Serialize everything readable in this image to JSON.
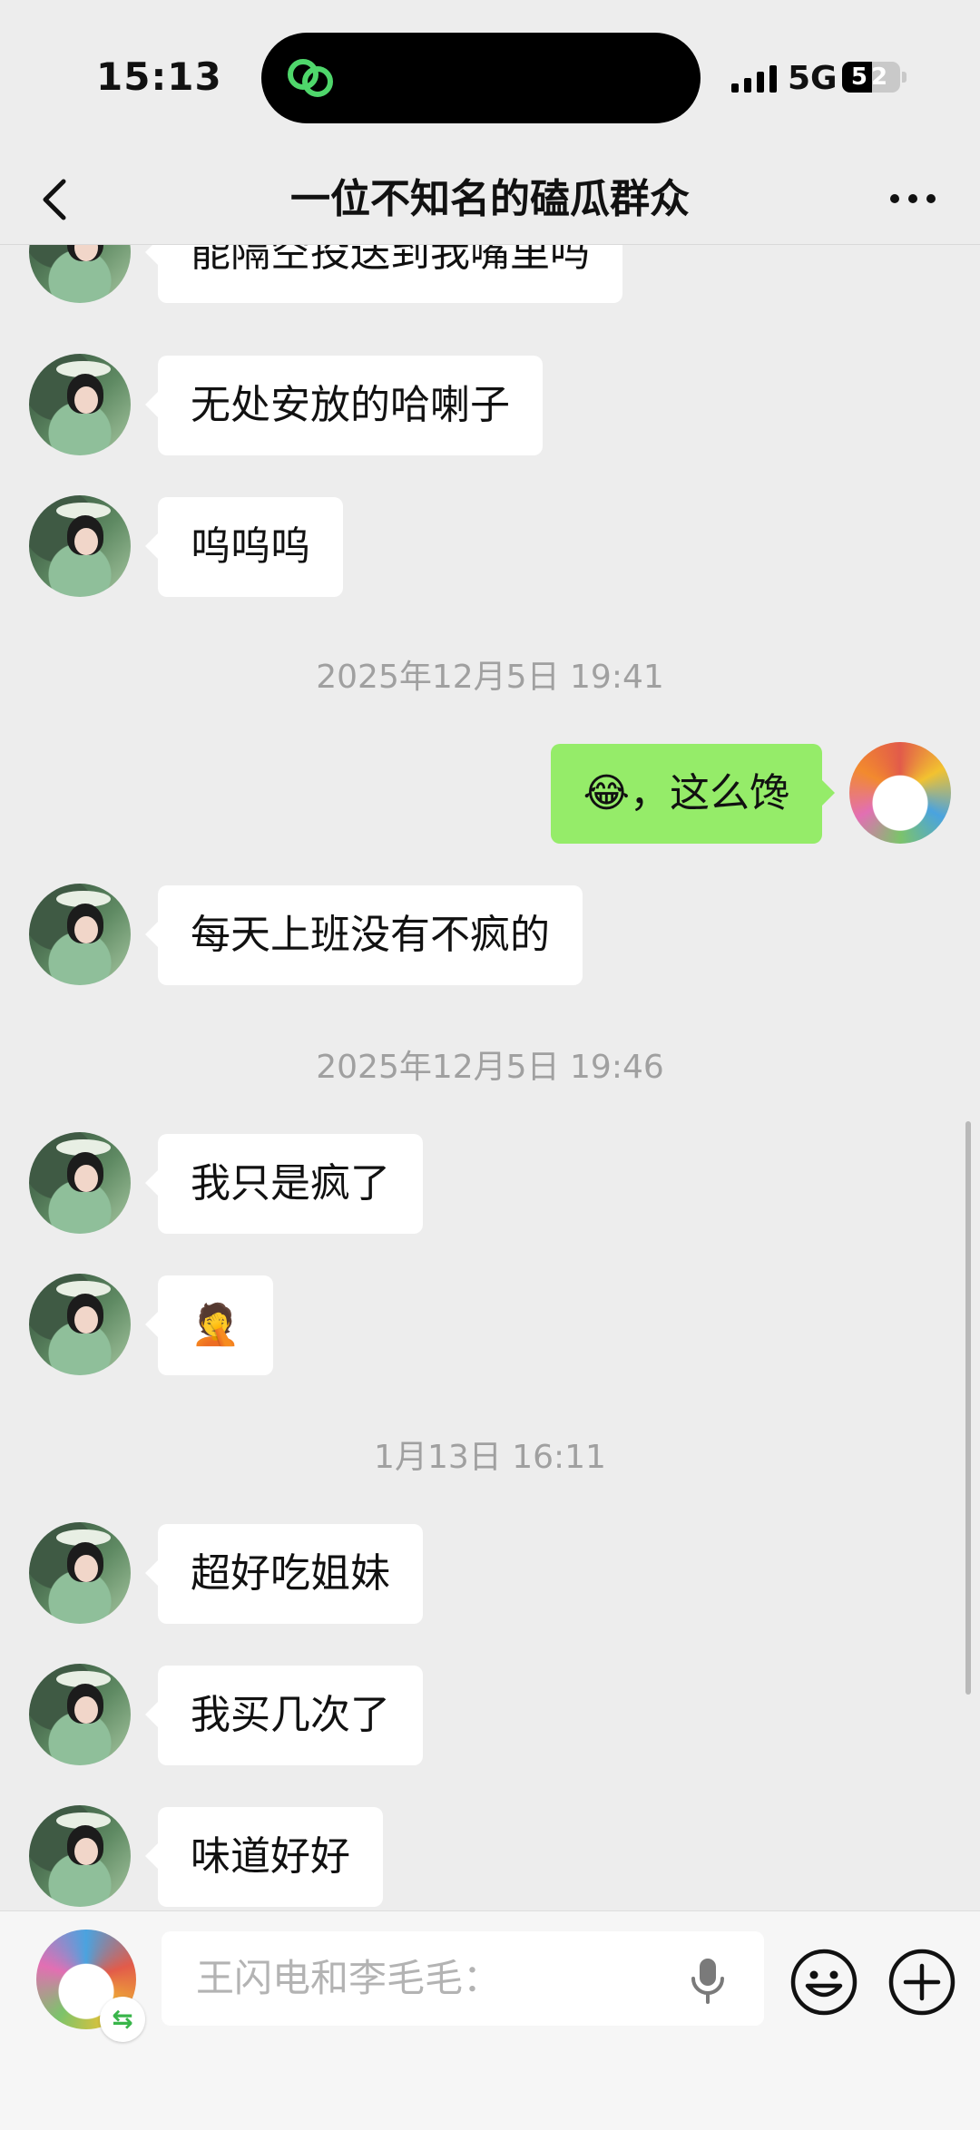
{
  "status_bar": {
    "time": "15:13",
    "network": "5G",
    "battery": "52",
    "battery_level": 0.52
  },
  "header": {
    "title": "一位不知名的磕瓜群众"
  },
  "messages": [
    {
      "side": "left",
      "text": "能隔空投送到我嘴里吗"
    },
    {
      "side": "left",
      "text": "无处安放的哈喇子"
    },
    {
      "side": "left",
      "text": "呜呜呜"
    },
    {
      "type": "timestamp",
      "text": "2025年12月5日 19:41"
    },
    {
      "side": "right",
      "emoji": "😂",
      "text": "，这么馋"
    },
    {
      "side": "left",
      "text": "每天上班没有不疯的"
    },
    {
      "type": "timestamp",
      "text": "2025年12月5日 19:46"
    },
    {
      "side": "left",
      "text": "我只是疯了"
    },
    {
      "side": "left",
      "emoji": "🤦"
    },
    {
      "type": "timestamp",
      "text": "1月13日 16:11"
    },
    {
      "side": "left",
      "text": "超好吃姐妹"
    },
    {
      "side": "left",
      "text": "我买几次了"
    },
    {
      "side": "left",
      "text": "味道好好"
    }
  ],
  "input": {
    "placeholder": "王闪电和李毛毛："
  },
  "icons": {
    "back": "chevron-left-icon",
    "more": "more-dots-icon",
    "mic": "microphone-icon",
    "emoji": "smiley-icon",
    "add": "plus-circle-icon",
    "switch": "switch-arrows-icon"
  },
  "colors": {
    "background": "#ededed",
    "bubble_self": "#95ec69",
    "bubble_other": "#ffffff",
    "timestamp": "#a0a0a0"
  }
}
